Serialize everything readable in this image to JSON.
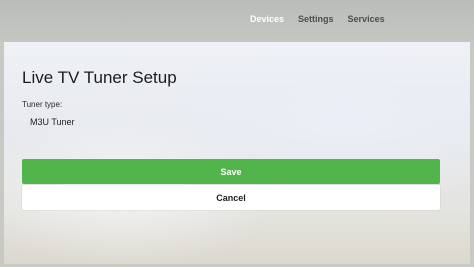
{
  "nav": {
    "items": [
      {
        "label": "Devices",
        "active": true
      },
      {
        "label": "Settings",
        "active": false
      },
      {
        "label": "Services",
        "active": false
      }
    ]
  },
  "page": {
    "title": "Live TV Tuner Setup"
  },
  "form": {
    "tuner_type_label": "Tuner type:",
    "tuner_type_value": "M3U Tuner"
  },
  "buttons": {
    "save_label": "Save",
    "cancel_label": "Cancel"
  },
  "colors": {
    "accent": "#52b54b",
    "nav_active": "#ffffff",
    "nav_inactive": "#4e4f4c"
  }
}
